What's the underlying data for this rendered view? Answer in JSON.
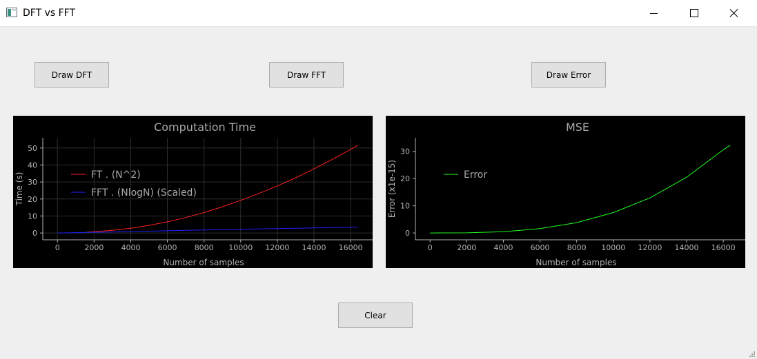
{
  "window": {
    "title": "DFT vs FFT",
    "icon": "app-window-icon",
    "controls": [
      "minimize-icon",
      "maximize-icon",
      "close-icon"
    ]
  },
  "buttons": {
    "draw_dft": "Draw DFT",
    "draw_fft": "Draw FFT",
    "draw_error": "Draw Error",
    "clear": "Clear"
  },
  "colors": {
    "window_bg": "#efefef",
    "plot_bg": "#000000",
    "axis": "#b4b4b4",
    "grid": "#2e2e2e",
    "dft_line": "#ff2020",
    "fft_line": "#2020ff",
    "error_line": "#20ff20"
  },
  "chart_data": [
    {
      "type": "line",
      "title": "Computation Time",
      "xlabel": "Number of samples",
      "ylabel": "Time (s)",
      "xlim": [
        -800,
        17200
      ],
      "ylim": [
        -4,
        56
      ],
      "xticks": [
        0,
        2000,
        4000,
        6000,
        8000,
        10000,
        12000,
        14000,
        16000
      ],
      "yticks": [
        0,
        10,
        20,
        30,
        40,
        50
      ],
      "grid": true,
      "legend_position": "top-left",
      "series": [
        {
          "name": "FT . (N^2)",
          "color": "#ff2020",
          "x": [
            1600,
            2000,
            3000,
            4000,
            5000,
            6000,
            7000,
            8000,
            9000,
            10000,
            11000,
            12000,
            13000,
            14000,
            15000,
            16000,
            16384
          ],
          "y": [
            0.5,
            0.8,
            1.6,
            2.8,
            4.5,
            6.6,
            9.1,
            12.0,
            15.4,
            19.2,
            23.3,
            27.7,
            32.5,
            37.7,
            43.3,
            49.2,
            51.5
          ]
        },
        {
          "name": "FFT . (NlogN) (Scaled)",
          "color": "#2020ff",
          "x": [
            0,
            2000,
            4000,
            6000,
            8000,
            10000,
            12000,
            14000,
            16000,
            16384
          ],
          "y": [
            0.0,
            0.4,
            0.8,
            1.3,
            1.8,
            2.2,
            2.6,
            3.0,
            3.4,
            3.5
          ]
        }
      ]
    },
    {
      "type": "line",
      "title": "MSE",
      "xlabel": "Number of samples",
      "ylabel": "Error (x1e-15)",
      "xlim": [
        -800,
        17200
      ],
      "ylim": [
        -2.5,
        35
      ],
      "xticks": [
        0,
        2000,
        4000,
        6000,
        8000,
        10000,
        12000,
        14000,
        16000
      ],
      "yticks": [
        0,
        10,
        20,
        30
      ],
      "grid": false,
      "legend_position": "top-left",
      "series": [
        {
          "name": "Error",
          "color": "#20ff20",
          "x": [
            0,
            2000,
            4000,
            6000,
            8000,
            10000,
            12000,
            14000,
            16000,
            16384
          ],
          "y": [
            0.0,
            0.06,
            0.47,
            1.6,
            3.8,
            7.5,
            12.9,
            20.5,
            30.6,
            32.3
          ]
        }
      ]
    }
  ]
}
